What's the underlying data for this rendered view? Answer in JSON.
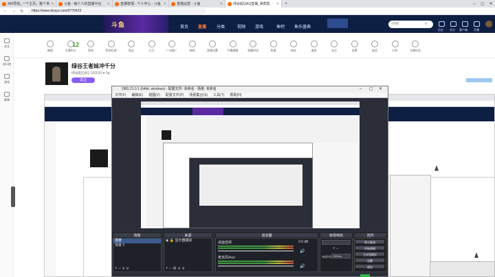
{
  "browser": {
    "tabs": [
      {
        "label": "360导航_一个主页，整个世"
      },
      {
        "label": "斗鱼 - 每个人的直播平台"
      },
      {
        "label": "直播管理 - 个人中心 - 斗鱼"
      },
      {
        "label": "直播运营 - 斗鱼"
      },
      {
        "label": "绿谷起QAQ直播_吴帮影"
      }
    ],
    "url": "https://www.douyu.com/9770423"
  },
  "header": {
    "banner_text": "斗鱼",
    "nav": [
      "首页",
      "直播",
      "分类",
      "视频",
      "游戏",
      "鱼吧",
      "鱼乐盛典"
    ],
    "search_placeholder": "搜索",
    "user_icons": [
      "历史",
      "关注",
      "客户端",
      "开播"
    ]
  },
  "sidebar": {
    "items": [
      "关注",
      "排行榜",
      "游戏",
      "赛事"
    ]
  },
  "tools": {
    "items": [
      "峰值",
      "主播积分",
      "签到",
      "签到礼物",
      "鱼丸",
      "大力",
      "广告推广",
      "视频",
      "直播设置",
      "开播提醒",
      "直播时间",
      "鱼塘",
      "粉丝",
      "道具",
      "关注",
      "设置",
      "抽奖",
      "红包",
      "主播任务"
    ],
    "score": "12"
  },
  "room": {
    "title": "绿谷王者妹冲千分",
    "subtitle": "绿谷起QAQ  100010  ♥ 0g",
    "follow_label": "关注"
  },
  "obs": {
    "title": "OBS 21.0.1 (64bit, windows) - 配置文件: 未命名 - 场景: 未命名",
    "menu": [
      "文件(F)",
      "编辑(E)",
      "视图(V)",
      "配置文件(P)",
      "场景集合(S)",
      "工具(T)",
      "帮助(H)"
    ],
    "docks": {
      "scenes": "场景",
      "sources": "来源",
      "mixer": "混音器",
      "transitions": "转场特效",
      "controls": "控件"
    },
    "scene_items": [
      "场景",
      "场景 2"
    ],
    "source_items": [
      "显示器捕获"
    ],
    "mixer_items": [
      "桌面音频",
      "麦克风/Aux"
    ],
    "duration_label": "持续时间",
    "duration_value": "300ms",
    "controls": [
      "停止推流",
      "开始录制",
      "工作室模式",
      "设置",
      "退出"
    ]
  }
}
